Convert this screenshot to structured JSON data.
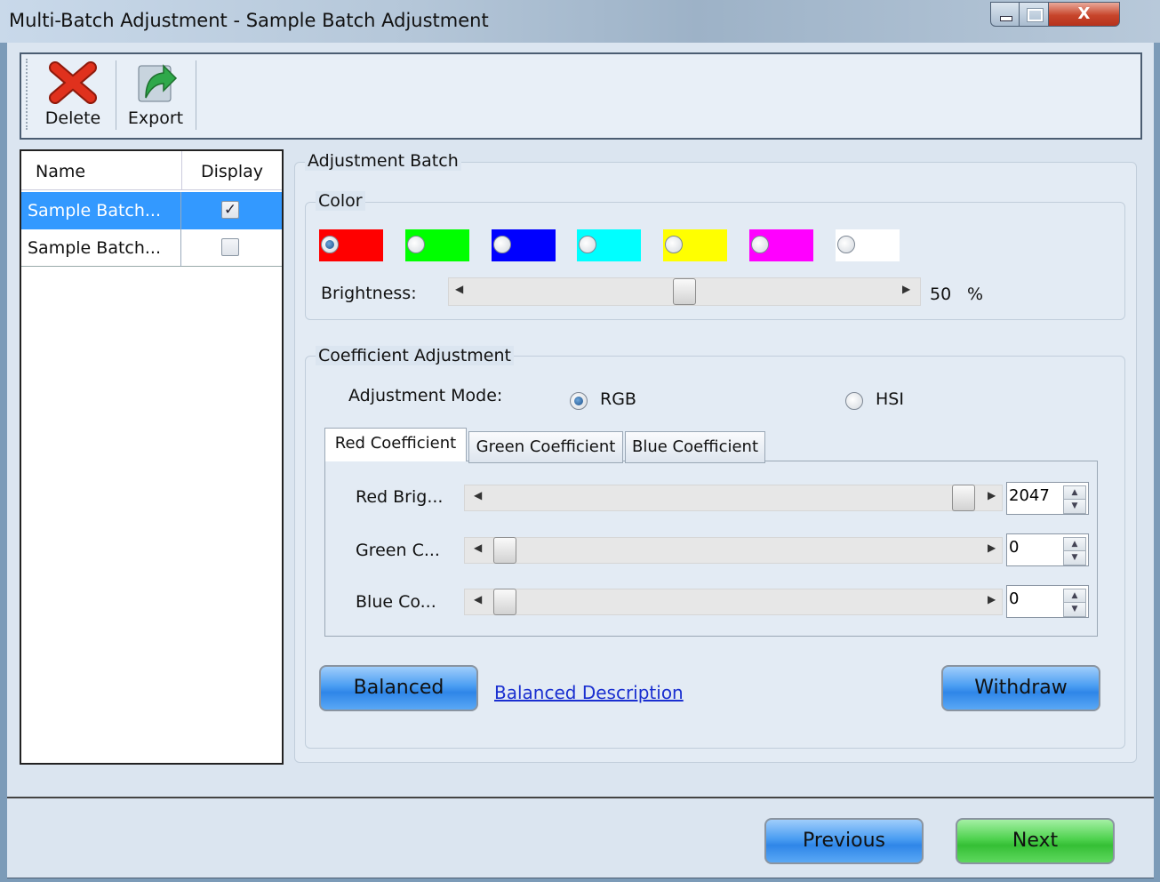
{
  "window": {
    "title": "Multi-Batch Adjustment - Sample Batch Adjustment",
    "close_glyph": "X"
  },
  "toolbar": {
    "delete_label": "Delete",
    "export_label": "Export"
  },
  "batch_list": {
    "headers": {
      "name": "Name",
      "display": "Display"
    },
    "rows": [
      {
        "name": "Sample Batch...",
        "display": true,
        "selected": true
      },
      {
        "name": "Sample Batch...",
        "display": false,
        "selected": false
      }
    ],
    "check_glyph": "✓"
  },
  "adjustment_batch": {
    "legend": "Adjustment Batch",
    "color": {
      "legend": "Color",
      "swatches": [
        "#ff0000",
        "#00ff00",
        "#0000ff",
        "#00ffff",
        "#ffff00",
        "#ff00ff",
        "#ffffff"
      ],
      "selected_index": 0,
      "brightness_label": "Brightness:",
      "brightness_value": "50",
      "brightness_unit": "%",
      "brightness_fraction": 0.5
    },
    "coefficient": {
      "legend": "Coefficient Adjustment",
      "mode_label": "Adjustment Mode:",
      "modes": {
        "rgb": "RGB",
        "hsi": "HSI"
      },
      "selected_mode": "RGB",
      "tabs": [
        "Red Coefficient",
        "Green Coefficient",
        "Blue Coefficient"
      ],
      "active_tab": 0,
      "sliders": [
        {
          "label": "Red Brig...",
          "value": "2047",
          "fraction": 1.0
        },
        {
          "label": "Green C...",
          "value": "0",
          "fraction": 0.0
        },
        {
          "label": "Blue Co...",
          "value": "0",
          "fraction": 0.0
        }
      ],
      "arrow_left": "◀",
      "arrow_right": "▶",
      "spin_up": "▲",
      "spin_down": "▼"
    },
    "balanced_label": "Balanced",
    "balanced_description": "Balanced Description",
    "withdraw_label": "Withdraw"
  },
  "footer": {
    "previous_label": "Previous",
    "next_label": "Next"
  }
}
